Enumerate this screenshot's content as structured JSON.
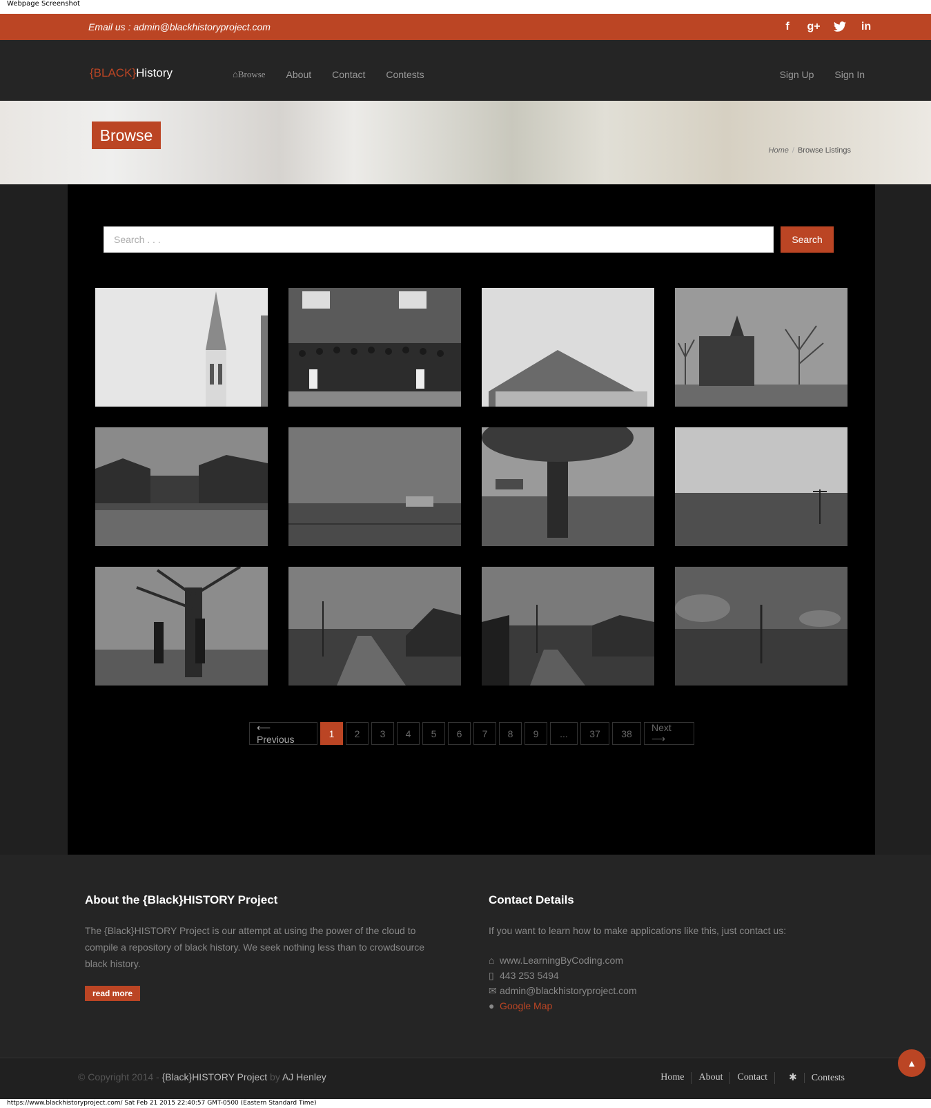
{
  "window": {
    "caption": "Webpage Screenshot",
    "status_line": "https://www.blackhistoryproject.com/ Sat Feb 21 2015 22:40:57 GMT-0500 (Eastern Standard Time)"
  },
  "topbar": {
    "email": "Email us : admin@blackhistoryproject.com",
    "social": [
      {
        "icon": "facebook-icon",
        "glyph": "f"
      },
      {
        "icon": "google-plus-icon",
        "glyph": "g+"
      },
      {
        "icon": "twitter-icon",
        "glyph": "t"
      },
      {
        "icon": "linkedin-icon",
        "glyph": "in"
      }
    ]
  },
  "nav": {
    "logo_prefix": "{BLACK}",
    "logo_suffix": "History",
    "browse": "Browse",
    "about": "About",
    "contact": "Contact",
    "contests": "Contests",
    "signup": "Sign Up",
    "signin": "Sign In"
  },
  "banner": {
    "title": "Browse",
    "crumb_home": "Home",
    "crumb_sep": "/",
    "crumb_current": "Browse Listings"
  },
  "search": {
    "placeholder": "Search . . .",
    "button": "Search"
  },
  "pagination": {
    "prev": "⟵ Previous",
    "pages": [
      "1",
      "2",
      "3",
      "4",
      "5",
      "6",
      "7",
      "8",
      "9",
      "...",
      "37",
      "38"
    ],
    "active": "1",
    "next": "Next ⟶"
  },
  "footer": {
    "about_title": "About the {Black}HISTORY Project",
    "about_text": "The {Black}HISTORY Project is our attempt at using the power of the cloud to compile a repository of black history. We seek nothing less than to crowdsource black history.",
    "read_more": "read more",
    "contact_title": "Contact Details",
    "contact_intro": "If you want to learn how to make applications like this, just contact us:",
    "website": "www.LearningByCoding.com",
    "phone": "443 253 5494",
    "email": "admin@blackhistoryproject.com",
    "map": "Google Map"
  },
  "bottom": {
    "copyright_prefix": "© Copyright 2014 -",
    "project": "{Black}HISTORY Project",
    "by": "by",
    "author": "AJ Henley",
    "links": [
      "Home",
      "About",
      "Contact",
      "Contests"
    ]
  },
  "colors": {
    "accent": "#bb4524",
    "dark": "#252525",
    "black": "#000000"
  }
}
